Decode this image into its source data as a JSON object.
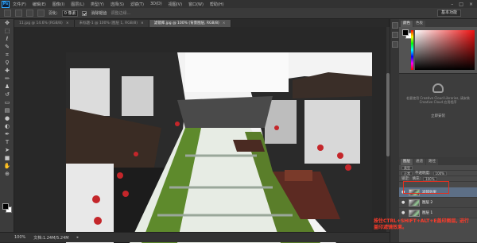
{
  "menubar": {
    "logo": "Ps",
    "items": [
      "文件(F)",
      "编辑(E)",
      "图像(I)",
      "图层(L)",
      "类型(Y)",
      "选择(S)",
      "滤镜(T)",
      "3D(D)",
      "视图(V)",
      "窗口(W)",
      "帮助(H)"
    ]
  },
  "options": {
    "feather_label": "羽化:",
    "feather_value": "0 像素",
    "antialias_label": "消除锯齿",
    "style_label": "调整边缘...",
    "workspace": "基本功能"
  },
  "tabs": [
    {
      "label": "11.jpg @ 14.6% (RGB/8)",
      "active": false
    },
    {
      "label": "未标题-1 @ 100% (图层 1, RGB/8)",
      "active": false
    },
    {
      "label": "滤镜库.jpg @ 100% (背景图层, RGB/8)",
      "active": true
    }
  ],
  "status": {
    "zoom": "100%",
    "doc": "文档:1.24M/5.24M"
  },
  "panels": {
    "tabs": [
      "颜色",
      "色板"
    ],
    "colors": {
      "fg": "#000000",
      "bg": "#ffffff",
      "selected_layer": "#5d6f86",
      "highlight": "#e23020"
    }
  },
  "cc": {
    "text": "若要使用 Creative Cloud Libraries, 请安装 Creative Cloud 应用程序",
    "link": "立即安装"
  },
  "layers": {
    "tabs": [
      "图层",
      "通道",
      "路径"
    ],
    "kind_label": "类型",
    "mode": "正常",
    "opacity_label": "不透明度:",
    "opacity_value": "100%",
    "lock_label": "锁定:",
    "fill_label": "填充:",
    "fill_value": "100%",
    "items": [
      {
        "name": "滤镜效果",
        "selected": true
      },
      {
        "name": "图层 2",
        "selected": false
      },
      {
        "name": "图层 1",
        "selected": false
      }
    ]
  },
  "caption": "按住CTRL+SHIFT+ALT+E盖印图层, 进行盖印滤镜效果。"
}
